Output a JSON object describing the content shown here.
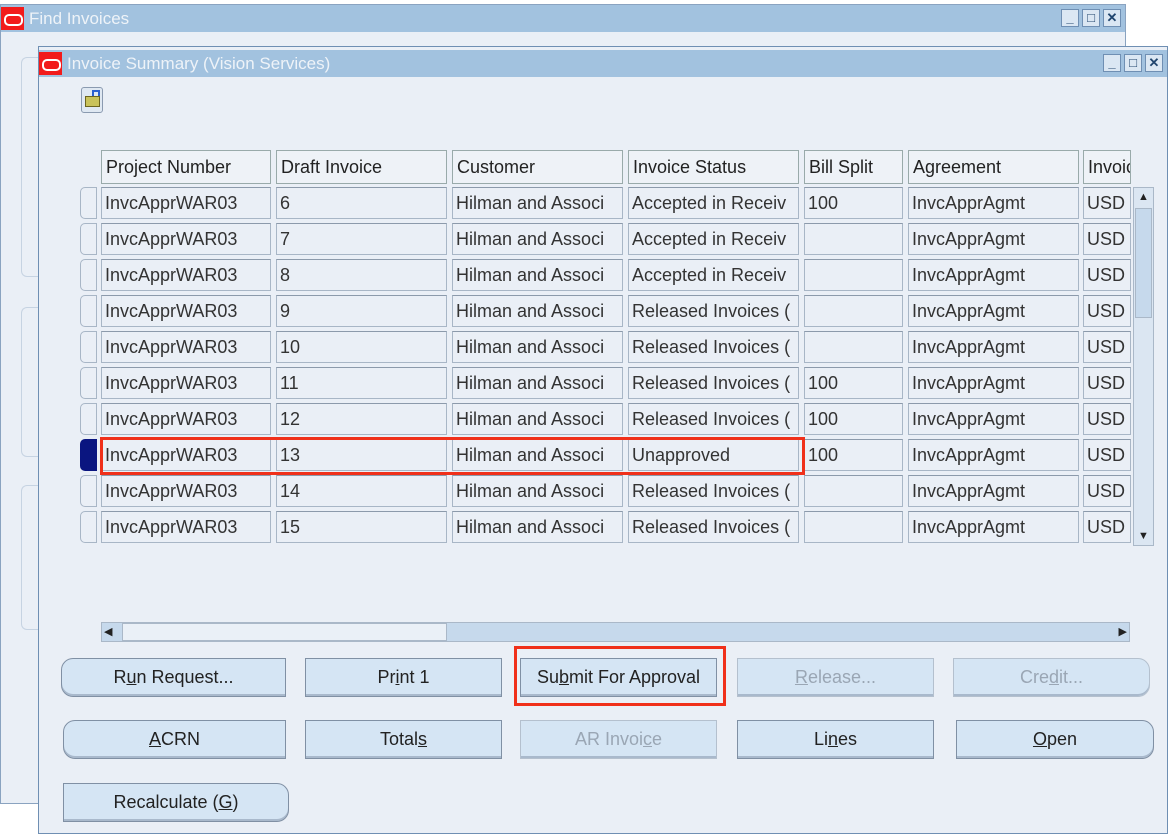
{
  "outer_window": {
    "title": "Find Invoices"
  },
  "window": {
    "title": "Invoice Summary (Vision Services)",
    "minimize": "_",
    "maximize": "□",
    "close": "✕"
  },
  "toolbar": {
    "icon": "open-folder-icon"
  },
  "table": {
    "columns": [
      "Project Number",
      "Draft Invoice",
      "Customer",
      "Invoice Status",
      "Bill Split",
      "Agreement",
      "Invoic"
    ],
    "rows": [
      [
        "InvcApprWAR03",
        "6",
        "Hilman and Associ",
        "Accepted in Receiv",
        "100",
        "InvcApprAgmt",
        "USD"
      ],
      [
        "InvcApprWAR03",
        "7",
        "Hilman and Associ",
        "Accepted in Receiv",
        "",
        "InvcApprAgmt",
        "USD"
      ],
      [
        "InvcApprWAR03",
        "8",
        "Hilman and Associ",
        "Accepted in Receiv",
        "",
        "InvcApprAgmt",
        "USD"
      ],
      [
        "InvcApprWAR03",
        "9",
        "Hilman and Associ",
        "Released Invoices (",
        "",
        "InvcApprAgmt",
        "USD"
      ],
      [
        "InvcApprWAR03",
        "10",
        "Hilman and Associ",
        "Released Invoices (",
        "",
        "InvcApprAgmt",
        "USD"
      ],
      [
        "InvcApprWAR03",
        "11",
        "Hilman and Associ",
        "Released Invoices (",
        "100",
        "InvcApprAgmt",
        "USD"
      ],
      [
        "InvcApprWAR03",
        "12",
        "Hilman and Associ",
        "Released Invoices (",
        "100",
        "InvcApprAgmt",
        "USD"
      ],
      [
        "InvcApprWAR03",
        "13",
        "Hilman and Associ",
        "Unapproved",
        "100",
        "InvcApprAgmt",
        "USD"
      ],
      [
        "InvcApprWAR03",
        "14",
        "Hilman and Associ",
        "Released Invoices (",
        "",
        "InvcApprAgmt",
        "USD"
      ],
      [
        "InvcApprWAR03",
        "15",
        "Hilman and Associ",
        "Released Invoices (",
        "",
        "InvcApprAgmt",
        "USD"
      ]
    ],
    "selected_row": 7
  },
  "buttons": [
    {
      "pre": "R",
      "key": "u",
      "post": "n Request...",
      "enabled": true
    },
    {
      "pre": "Pr",
      "key": "i",
      "post": "nt 1",
      "enabled": true
    },
    {
      "pre": "Su",
      "key": "b",
      "post": "mit For Approval",
      "enabled": true
    },
    {
      "pre": "",
      "key": "R",
      "post": "elease...",
      "enabled": false
    },
    {
      "pre": "Cre",
      "key": "d",
      "post": "it...",
      "enabled": false
    },
    {
      "pre": "",
      "key": "A",
      "post": "CRN",
      "enabled": true
    },
    {
      "pre": "Total",
      "key": "s",
      "post": "",
      "enabled": true
    },
    {
      "pre": "AR Invoi",
      "key": "c",
      "post": "e",
      "enabled": false
    },
    {
      "pre": "Li",
      "key": "n",
      "post": "es",
      "enabled": true
    },
    {
      "pre": "",
      "key": "O",
      "post": "pen",
      "enabled": true
    },
    {
      "pre": "Recalculate (",
      "key": "G",
      "post": ")",
      "enabled": true
    }
  ],
  "colors": {
    "highlight": "#f0301a",
    "selected_marker": "#0a1580",
    "titlebar": "#a2c2df"
  }
}
